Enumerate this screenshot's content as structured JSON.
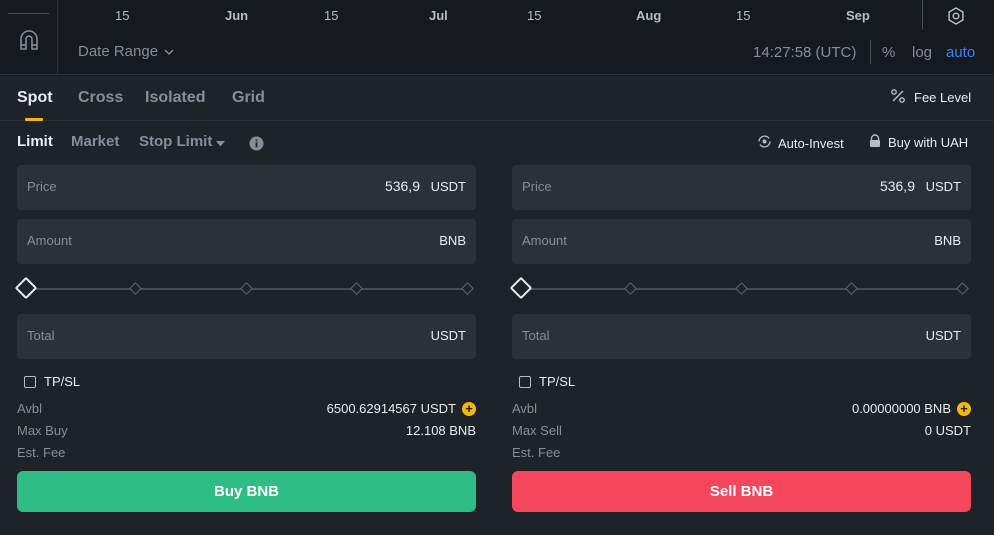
{
  "chart": {
    "axis_labels": [
      {
        "text": "15",
        "bold": false
      },
      {
        "text": "Jun",
        "bold": true
      },
      {
        "text": "15",
        "bold": false
      },
      {
        "text": "Jul",
        "bold": true
      },
      {
        "text": "15",
        "bold": false
      },
      {
        "text": "Aug",
        "bold": true
      },
      {
        "text": "15",
        "bold": false
      },
      {
        "text": "Sep",
        "bold": true
      }
    ],
    "date_range_label": "Date Range",
    "clock": "14:27:58 (UTC)",
    "percent_label": "%",
    "log_label": "log",
    "auto_label": "auto",
    "accent_color": "#3b82f6"
  },
  "mode_tabs": [
    "Spot",
    "Cross",
    "Isolated",
    "Grid"
  ],
  "fee_level_label": "Fee Level",
  "order_types": {
    "limit": "Limit",
    "market": "Market",
    "stop_limit": "Stop Limit"
  },
  "links": {
    "auto_invest": "Auto-Invest",
    "buy_with": "Buy with UAH"
  },
  "buy": {
    "price_label": "Price",
    "price_value": "536,9",
    "price_unit": "USDT",
    "amount_label": "Amount",
    "amount_unit": "BNB",
    "total_label": "Total",
    "total_unit": "USDT",
    "tpsl_label": "TP/SL",
    "avbl_label": "Avbl",
    "avbl_value": "6500.62914567 USDT",
    "max_label": "Max Buy",
    "max_value": "12.108 BNB",
    "fee_label": "Est. Fee",
    "button_label": "Buy BNB",
    "button_color": "#2ebd85"
  },
  "sell": {
    "price_label": "Price",
    "price_value": "536,9",
    "price_unit": "USDT",
    "amount_label": "Amount",
    "amount_unit": "BNB",
    "total_label": "Total",
    "total_unit": "USDT",
    "tpsl_label": "TP/SL",
    "avbl_label": "Avbl",
    "avbl_value": "0.00000000 BNB",
    "max_label": "Max Sell",
    "max_value": "0 USDT",
    "fee_label": "Est. Fee",
    "button_label": "Sell BNB",
    "button_color": "#f6465d"
  },
  "slider_level": 0,
  "highlight_color": "#f0b90b"
}
